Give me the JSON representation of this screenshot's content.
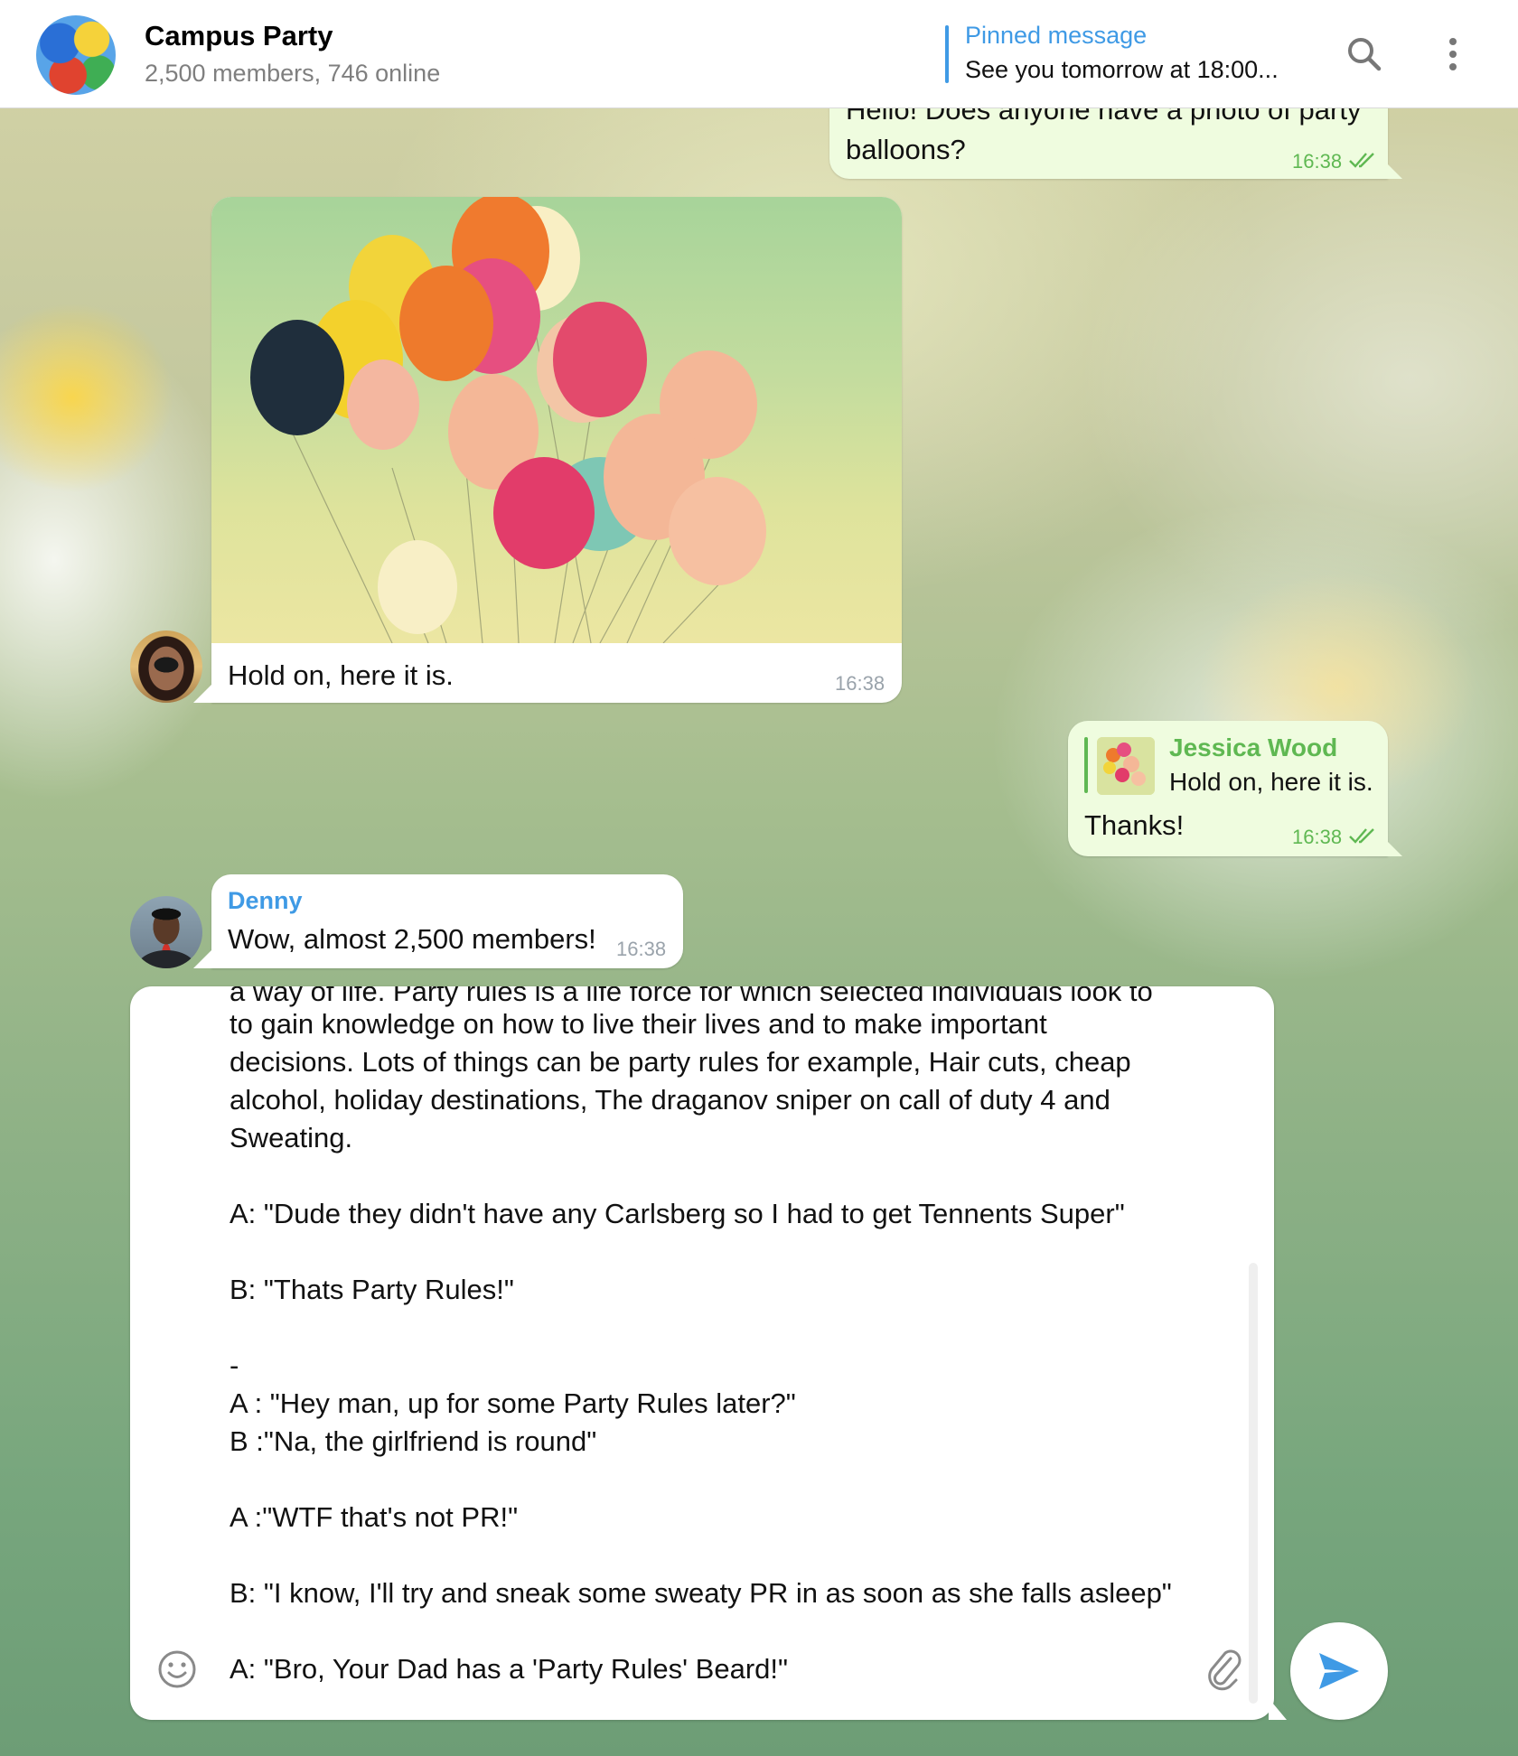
{
  "header": {
    "group_name": "Campus Party",
    "group_subtitle": "2,500 members, 746 online",
    "pinned_title": "Pinned message",
    "pinned_text": "See you tomorrow at 18:00..."
  },
  "messages": {
    "m1": {
      "text_line1": "Hello! Does anyone have a photo of party",
      "text_line2": "balloons?",
      "time": "16:38"
    },
    "m2": {
      "caption": "Hold on, here it is.",
      "time": "16:38"
    },
    "m3": {
      "reply_name": "Jessica Wood",
      "reply_text": "Hold on, here it is.",
      "text": "Thanks!",
      "time": "16:38"
    },
    "m4": {
      "sender": "Denny",
      "text": "Wow, almost 2,500 members!",
      "time": "16:38"
    }
  },
  "composer": {
    "lines": [
      "a way of life. Party rules is a life force for which selected individuals look to",
      "to gain knowledge on how to live their lives and to make important",
      "decisions. Lots of things can be party rules for example, Hair cuts, cheap",
      "alcohol, holiday destinations, The draganov sniper on call of duty 4 and",
      "Sweating.",
      "A: \"Dude they didn't have any Carlsberg so I had to get Tennents Super\"",
      "B: \"Thats Party Rules!\"",
      "-",
      "A : \"Hey man, up for some Party Rules later?\"",
      "B :\"Na, the girlfriend is round\"",
      "A :\"WTF that's not PR!\"",
      "B: \"I know, I'll try and sneak some sweaty PR in as soon as she falls asleep\"",
      "A: \"Bro, Your Dad has a 'Party Rules' Beard!\""
    ]
  },
  "colors": {
    "accent_blue": "#3f9ae5",
    "outgoing_bubble": "#effcdf",
    "outgoing_time": "#5fb852"
  },
  "icons": {
    "search": "search-icon",
    "menu": "more-vertical-icon",
    "emoji": "emoji-icon",
    "attach": "paperclip-icon",
    "send": "send-icon",
    "read": "double-check-icon"
  }
}
